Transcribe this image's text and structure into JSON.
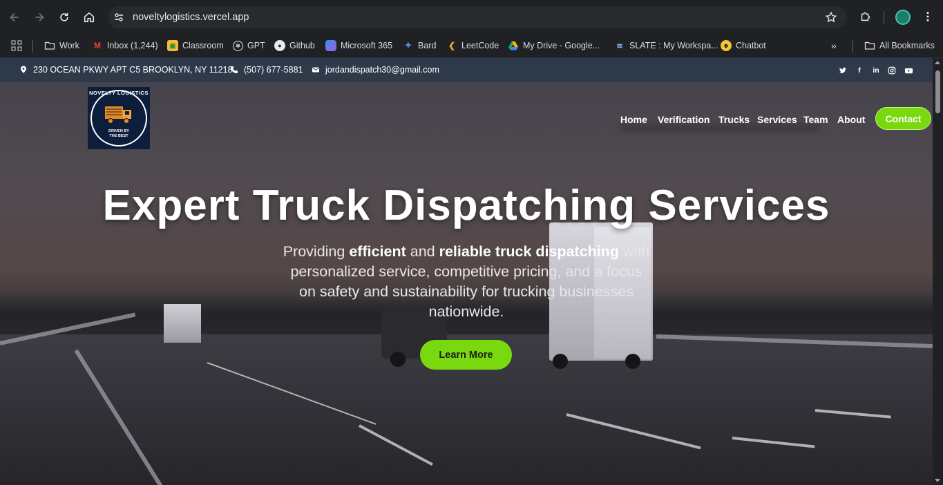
{
  "browser": {
    "url": "noveltylogistics.vercel.app",
    "bookmarks": [
      {
        "label": "Work",
        "icon": "folder-icon"
      },
      {
        "label": "Inbox (1,244)",
        "icon": "gmail-icon"
      },
      {
        "label": "Classroom",
        "icon": "classroom-icon"
      },
      {
        "label": "GPT",
        "icon": "openai-icon"
      },
      {
        "label": "Github",
        "icon": "github-icon"
      },
      {
        "label": "Microsoft 365",
        "icon": "microsoft365-icon"
      },
      {
        "label": "Bard",
        "icon": "bard-icon"
      },
      {
        "label": "LeetCode",
        "icon": "leetcode-icon"
      },
      {
        "label": "My Drive - Google...",
        "icon": "google-drive-icon"
      },
      {
        "label": "SLATE : My Workspa...",
        "icon": "slate-icon"
      },
      {
        "label": "Chatbot",
        "icon": "chatbot-icon"
      }
    ],
    "all_bookmarks": "All Bookmarks"
  },
  "topbar": {
    "address": "230 OCEAN PKWY APT C5 BROOKLYN, NY 11218",
    "phone": "(507) 677-5881",
    "email": "jordandispatch30@gmail.com",
    "social": [
      "twitter-icon",
      "facebook-icon",
      "linkedin-icon",
      "instagram-icon",
      "youtube-icon"
    ]
  },
  "logo": {
    "brand": "NOVELTY LOGISTICS",
    "tagline_1": "DRIVEN BY",
    "tagline_2": "THE BEST"
  },
  "nav": {
    "items": [
      "Home",
      "Verification",
      "Trucks",
      "Services",
      "Team",
      "About"
    ],
    "contact": "Contact"
  },
  "hero": {
    "title": "Expert Truck Dispatching Services",
    "sub_1": "Providing ",
    "sub_b1": "efficient",
    "sub_2": " and ",
    "sub_b2": "reliable truck dispatching",
    "sub_3": " with personalized service, competitive pricing, and a focus on safety and sustainability for trucking businesses nationwide.",
    "cta": "Learn More"
  },
  "colors": {
    "accent": "#7ad90e",
    "topbar": "#2e3a4a",
    "logo_bg": "#0d1e3d"
  }
}
